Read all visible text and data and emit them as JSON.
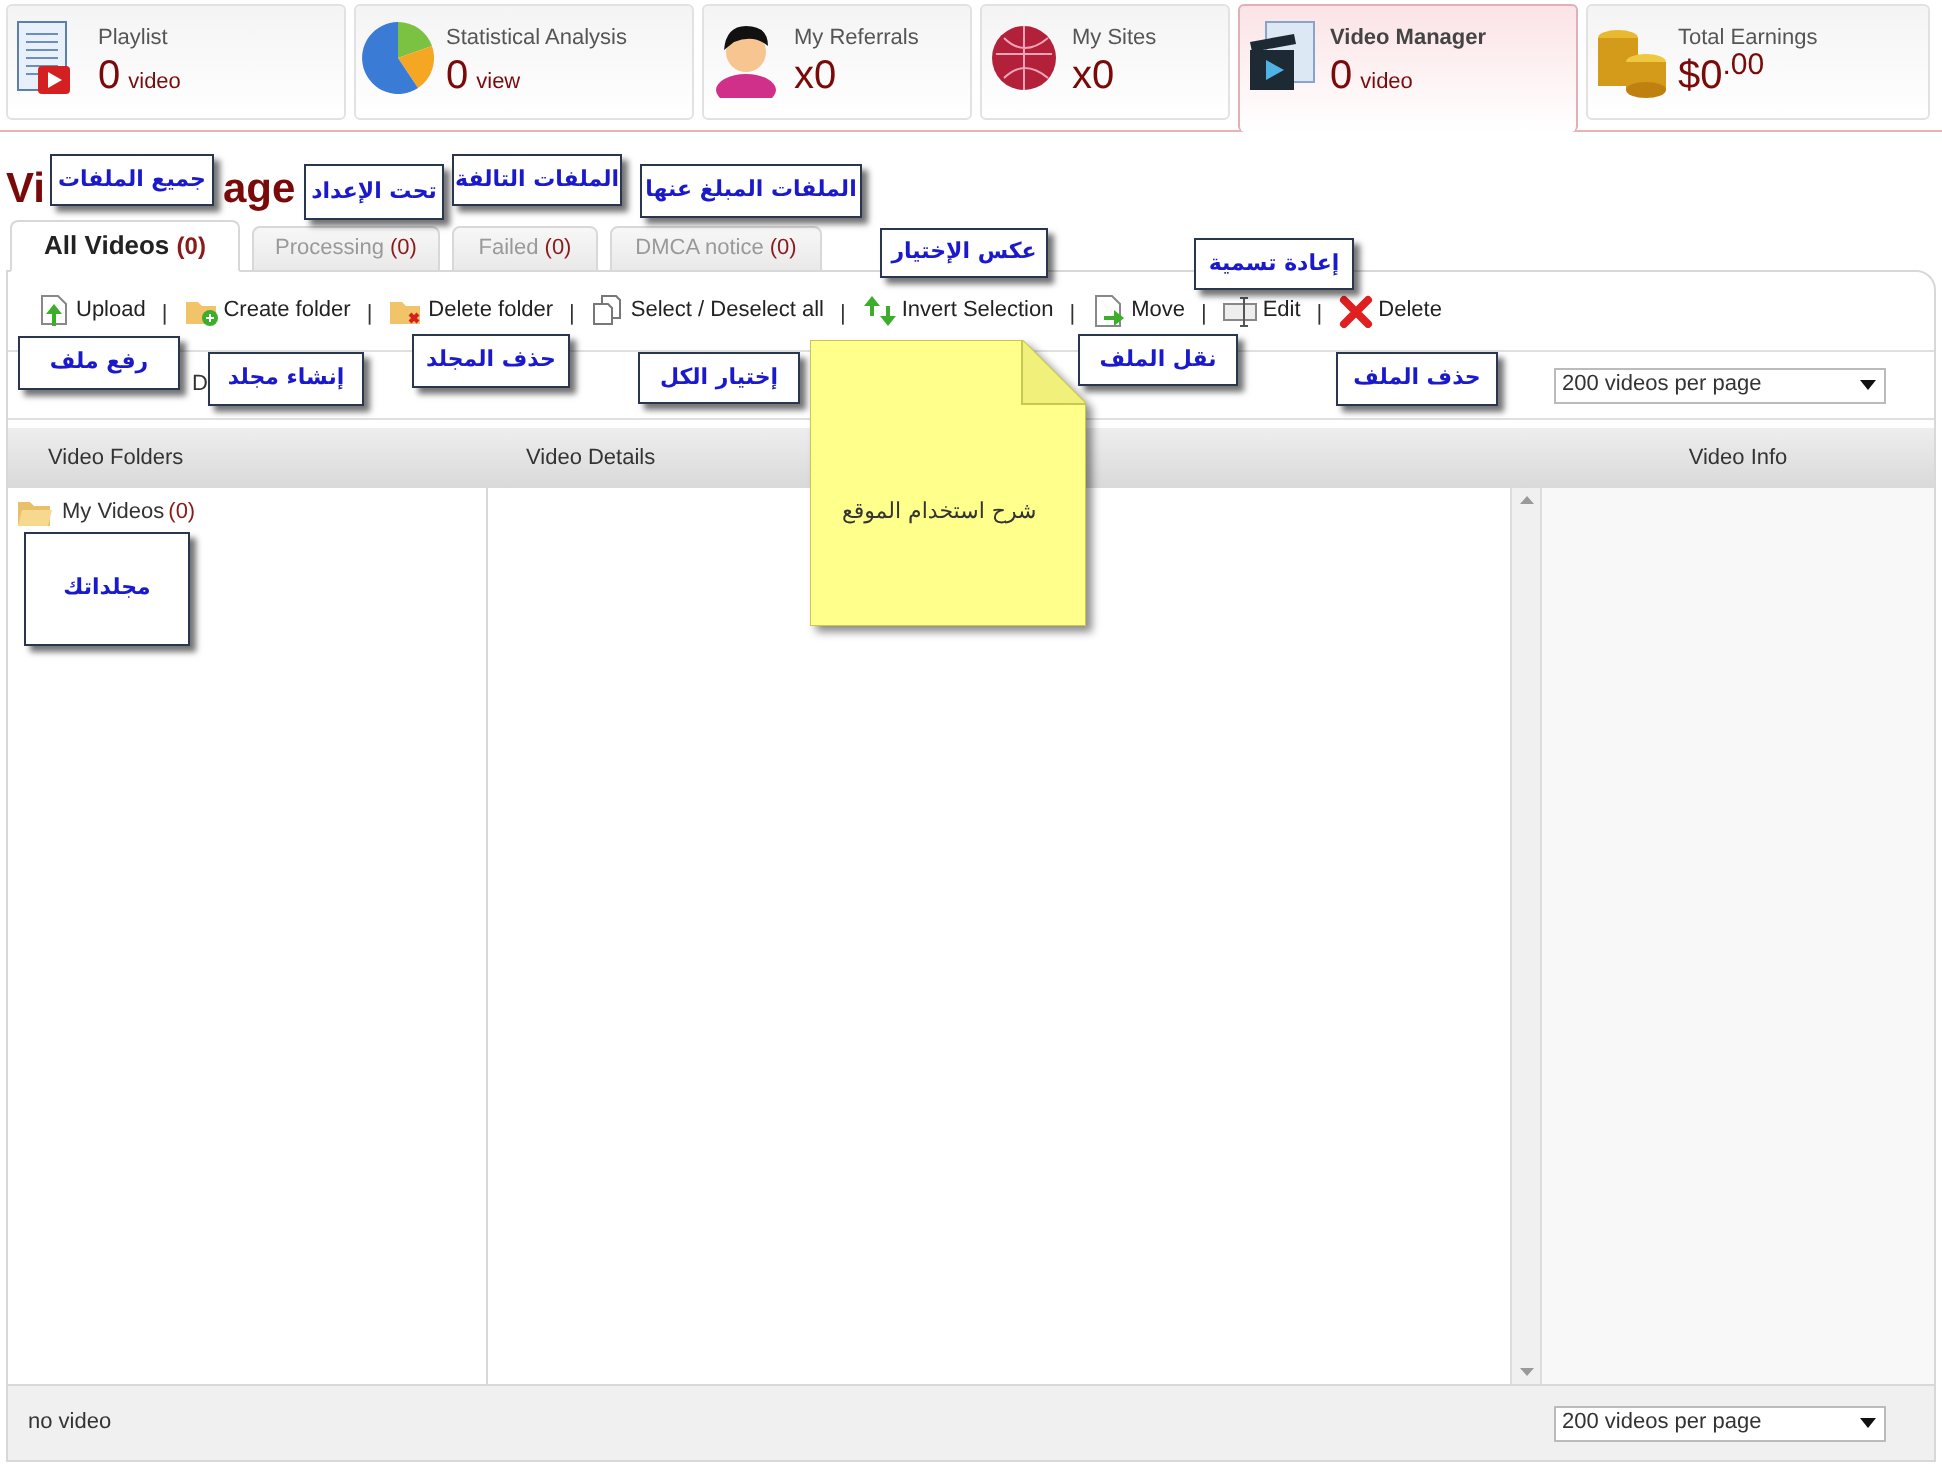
{
  "stat_cards": [
    {
      "kind": "playlist",
      "label": "Playlist",
      "value": "0",
      "unit": "video",
      "selected": false
    },
    {
      "kind": "statistics",
      "label": "Statistical Analysis",
      "value": "0",
      "unit": "view",
      "selected": false
    },
    {
      "kind": "referrals",
      "label": "My Referrals",
      "value": "x0",
      "selected": false
    },
    {
      "kind": "sites",
      "label": "My Sites",
      "value": "x0",
      "selected": false
    },
    {
      "kind": "videos",
      "label": "Video Manager",
      "value": "0",
      "unit": "video",
      "selected": true
    },
    {
      "kind": "earnings",
      "label": "Total Earnings",
      "value": "$0$^{.00}$",
      "selected": false
    }
  ],
  "page_title_fragments": [
    "Vi",
    "age"
  ],
  "tabs": [
    {
      "label": "All Videos",
      "count": "(0)",
      "selected": true
    },
    {
      "label": "Processing",
      "count": "(0)",
      "selected": false
    },
    {
      "label": "Failed",
      "count": "(0)",
      "selected": false
    },
    {
      "label": "DMCA notice",
      "count": "(0)",
      "selected": false
    }
  ],
  "toolbar": [
    {
      "kind": "upload",
      "label": "Upload"
    },
    {
      "kind": "separator",
      "label": "|"
    },
    {
      "kind": "create-folder",
      "label": "Create folder"
    },
    {
      "kind": "separator",
      "label": "|"
    },
    {
      "kind": "delete-folder",
      "label": "Delete folder"
    },
    {
      "kind": "separator",
      "label": "|"
    },
    {
      "kind": "select-all",
      "label": "Select / Deselect all"
    },
    {
      "kind": "separator",
      "label": "|"
    },
    {
      "kind": "invert",
      "label": "Invert Selection"
    },
    {
      "kind": "separator",
      "label": "|"
    },
    {
      "kind": "move",
      "label": "Move"
    },
    {
      "kind": "separator",
      "label": "|"
    },
    {
      "kind": "edit",
      "label": "Edit"
    },
    {
      "kind": "separator",
      "label": "|"
    },
    {
      "kind": "delete",
      "label": "Delete"
    }
  ],
  "hidden_fragment": "D",
  "per_page_top": "200 videos per page",
  "columns": [
    "Video Folders",
    "Video Details",
    "Video Info"
  ],
  "folders": [
    {
      "label": "My Videos",
      "count": "(0)"
    }
  ],
  "footer": {
    "text": "no video",
    "per_page": "200 videos per page"
  },
  "annotations": [
    {
      "text": "جميع الملفات"
    },
    {
      "text": "تحت الإعداد"
    },
    {
      "text": "الملفات التالفة"
    },
    {
      "text": "الملفات المبلغ عنها"
    },
    {
      "text": "عكس الإختيار"
    },
    {
      "text": "إعادة تسمية"
    },
    {
      "text": "رفع ملف"
    },
    {
      "text": "إنشاء مجلد"
    },
    {
      "text": "حذف المجلد"
    },
    {
      "text": "إختيار الكل"
    },
    {
      "text": "نقل الملف"
    },
    {
      "text": "حذف الملف"
    },
    {
      "text": "مجلداتك"
    }
  ],
  "sticky_note": {
    "text": "شرح استخدام الموقع"
  }
}
